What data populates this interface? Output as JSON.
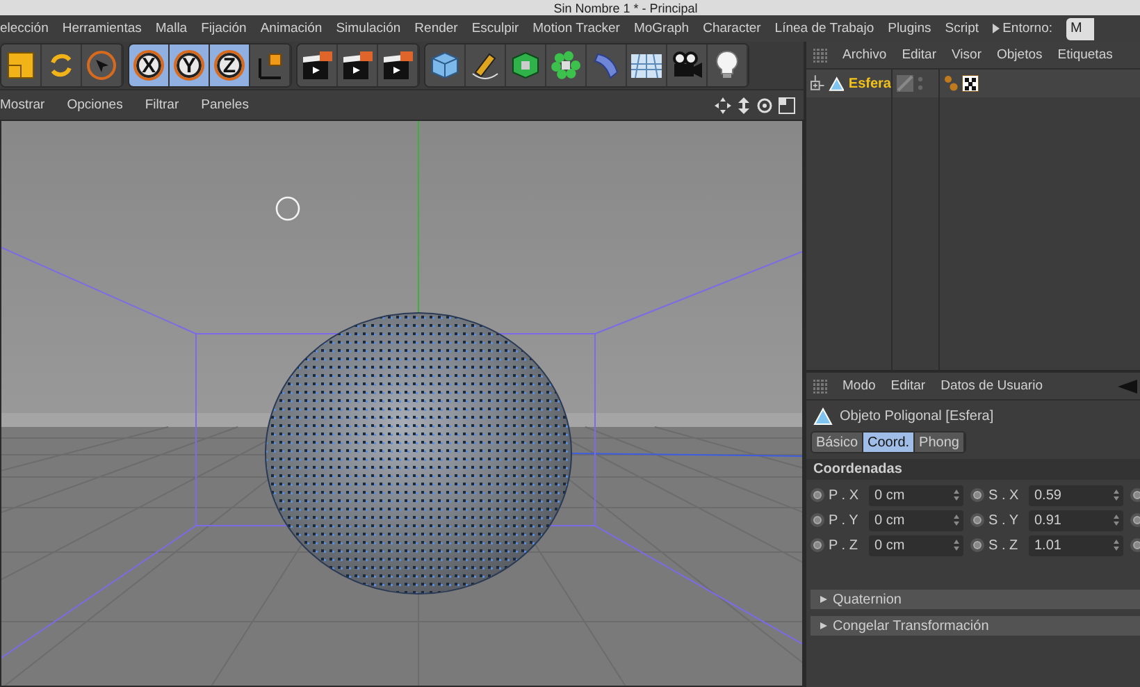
{
  "window": {
    "title": "Sin Nombre 1 * - Principal"
  },
  "menu": [
    "elección",
    "Herramientas",
    "Malla",
    "Fijación",
    "Animación",
    "Simulación",
    "Render",
    "Esculpir",
    "Motion Tracker",
    "MoGraph",
    "Character",
    "Línea de Trabajo",
    "Plugins",
    "Script"
  ],
  "layout_label": "Entorno:",
  "layout_value": "M",
  "toolbar": [
    [
      {
        "kind": "scale"
      },
      {
        "kind": "rotate"
      },
      {
        "kind": "select"
      }
    ],
    [
      {
        "kind": "axis",
        "label": "X",
        "selected": true
      },
      {
        "kind": "axis",
        "label": "Y",
        "selected": true
      },
      {
        "kind": "axis",
        "label": "Z",
        "selected": true
      },
      {
        "kind": "coords"
      }
    ],
    [
      {
        "kind": "clapper"
      },
      {
        "kind": "clapper"
      },
      {
        "kind": "clapper"
      }
    ],
    [
      {
        "kind": "cube"
      },
      {
        "kind": "pen"
      },
      {
        "kind": "greencube"
      },
      {
        "kind": "cloner"
      },
      {
        "kind": "deformer"
      },
      {
        "kind": "floor"
      },
      {
        "kind": "camera"
      },
      {
        "kind": "light"
      }
    ]
  ],
  "viewport": {
    "menu": [
      "Mostrar",
      "Opciones",
      "Filtrar",
      "Paneles"
    ]
  },
  "object_manager": {
    "menu": [
      "Archivo",
      "Editar",
      "Visor",
      "Objetos",
      "Etiquetas"
    ],
    "objects": [
      {
        "name": "Esfera",
        "selected": true
      }
    ]
  },
  "attribute_manager": {
    "menu": [
      "Modo",
      "Editar",
      "Datos de Usuario"
    ],
    "object_title": "Objeto Poligonal [Esfera]",
    "tabs": [
      {
        "label": "Básico",
        "selected": false
      },
      {
        "label": "Coord.",
        "selected": true
      },
      {
        "label": "Phong",
        "selected": false
      }
    ],
    "section": "Coordenadas",
    "rows": [
      [
        {
          "kind": "field",
          "keyed": false,
          "label": "P . X",
          "value": "0 cm"
        },
        {
          "kind": "field",
          "keyed": false,
          "label": "S . X",
          "value": "0.59"
        },
        {
          "kind": "radio",
          "keyed": false
        }
      ],
      [
        {
          "kind": "field",
          "keyed": false,
          "label": "P . Y",
          "value": "0 cm"
        },
        {
          "kind": "field",
          "keyed": false,
          "label": "S . Y",
          "value": "0.91"
        },
        {
          "kind": "radio",
          "keyed": false
        }
      ],
      [
        {
          "kind": "field",
          "keyed": false,
          "label": "P . Z",
          "value": "0 cm"
        },
        {
          "kind": "field",
          "keyed": false,
          "label": "S . Z",
          "value": "1.01"
        },
        {
          "kind": "radio",
          "keyed": false
        }
      ]
    ],
    "groups": [
      {
        "label": "Quaternion",
        "expanded": false
      },
      {
        "label": "Congelar Transformación",
        "expanded": false
      }
    ]
  }
}
